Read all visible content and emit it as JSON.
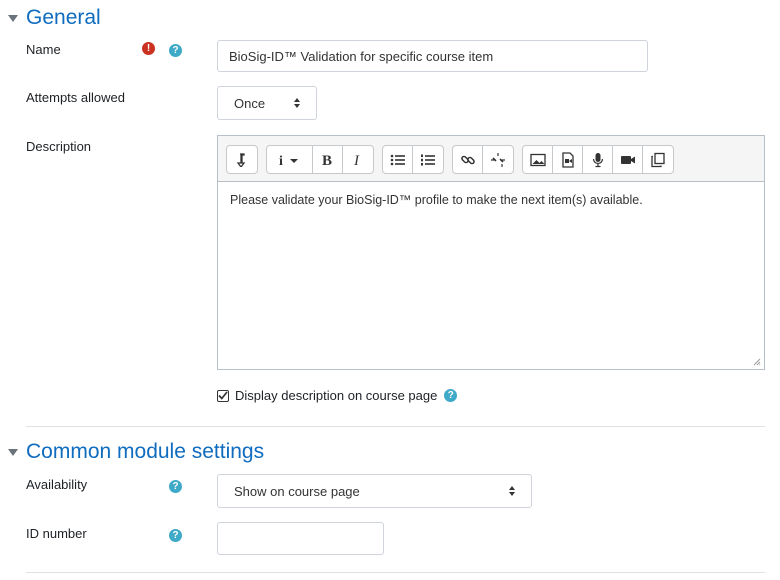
{
  "general": {
    "section_title": "General",
    "name": {
      "label": "Name",
      "value": "BioSig-ID™ Validation for specific course item"
    },
    "attempts": {
      "label": "Attempts allowed",
      "value": "Once"
    },
    "description": {
      "label": "Description",
      "text": "Please validate your BioSig-ID™ profile to make the next item(s) available."
    },
    "display_desc": {
      "label": "Display description on course page",
      "checked": true
    }
  },
  "common": {
    "section_title": "Common module settings",
    "availability": {
      "label": "Availability",
      "value": "Show on course page"
    },
    "id_number": {
      "label": "ID number",
      "value": ""
    }
  },
  "icons": {
    "required": "!",
    "help": "?",
    "collapse": "caret-down"
  },
  "colors": {
    "section_title": "#0f6cbf",
    "required": "#ca3120",
    "help": "#3fa9c8"
  }
}
